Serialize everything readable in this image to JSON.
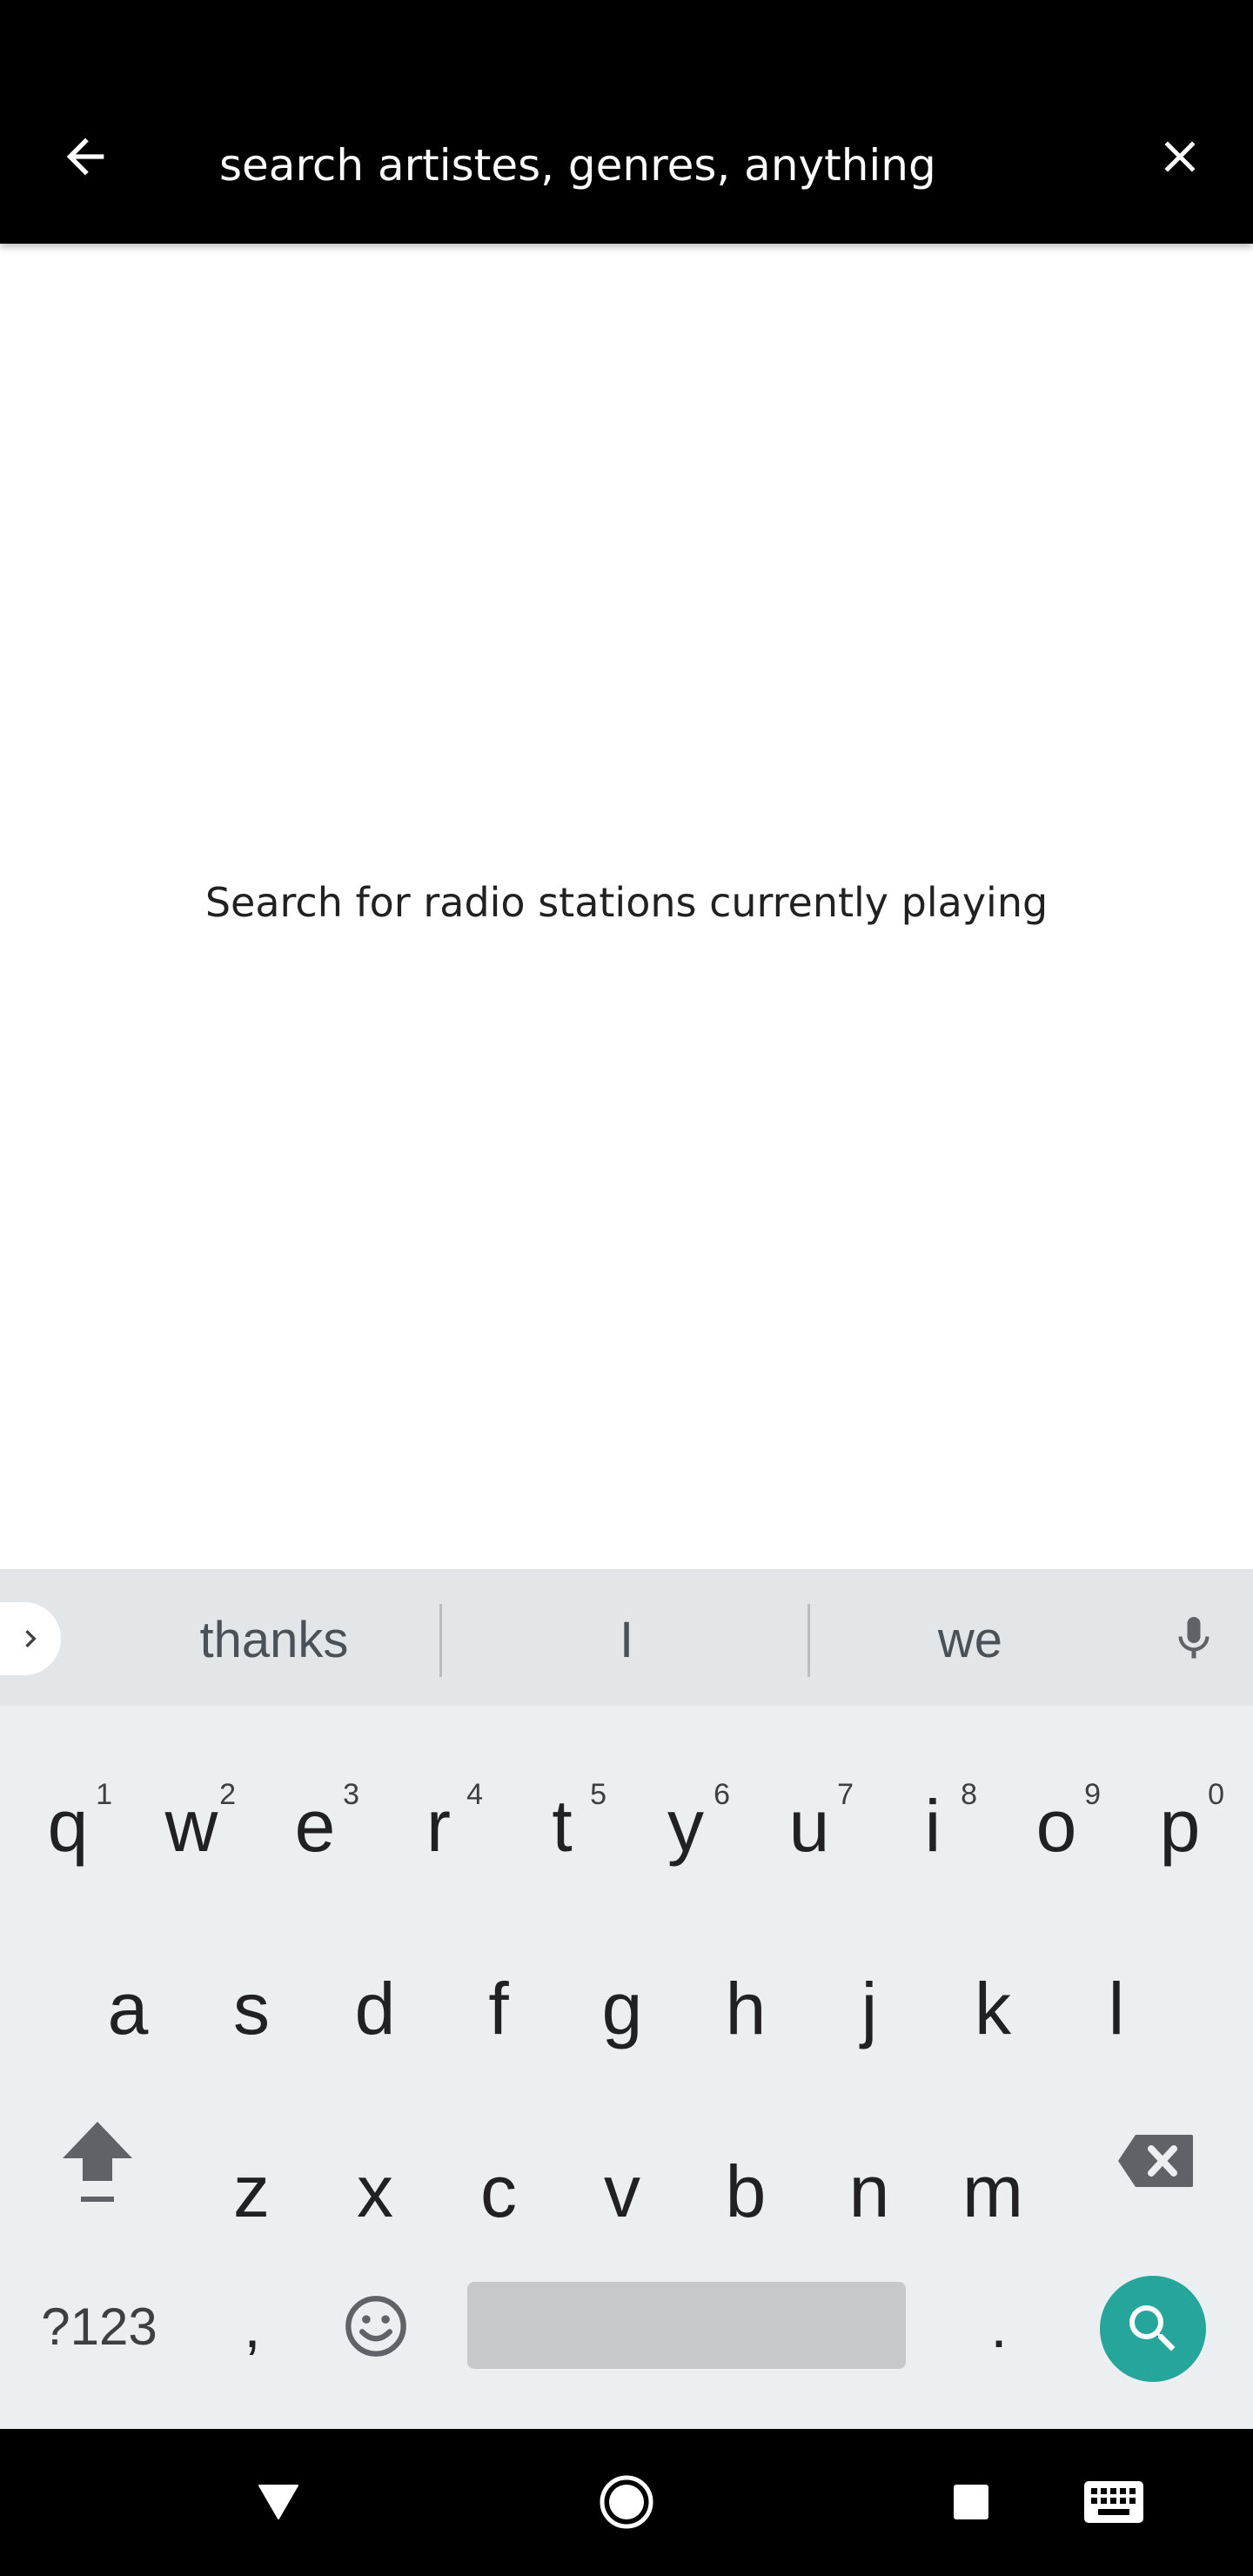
{
  "search": {
    "placeholder": "search artistes, genres, anything",
    "back_icon": "arrow-back-icon",
    "clear_icon": "close-icon"
  },
  "main": {
    "empty_message": "Search for radio stations currently playing"
  },
  "keyboard": {
    "suggestions": [
      "thanks",
      "I",
      "we"
    ],
    "row1": [
      {
        "key": "q",
        "hint": "1"
      },
      {
        "key": "w",
        "hint": "2"
      },
      {
        "key": "e",
        "hint": "3"
      },
      {
        "key": "r",
        "hint": "4"
      },
      {
        "key": "t",
        "hint": "5"
      },
      {
        "key": "y",
        "hint": "6"
      },
      {
        "key": "u",
        "hint": "7"
      },
      {
        "key": "i",
        "hint": "8"
      },
      {
        "key": "o",
        "hint": "9"
      },
      {
        "key": "p",
        "hint": "0"
      }
    ],
    "row2": [
      "a",
      "s",
      "d",
      "f",
      "g",
      "h",
      "j",
      "k",
      "l"
    ],
    "row3": [
      "z",
      "x",
      "c",
      "v",
      "b",
      "n",
      "m"
    ],
    "symbols_label": "?123",
    "comma_label": ",",
    "period_label": ".",
    "colors": {
      "accent": "#26a69a",
      "background": "#eceff1",
      "suggest_bg": "#e2e6e9"
    }
  },
  "colors": {
    "topbar": "#000000",
    "text": "#212121"
  }
}
